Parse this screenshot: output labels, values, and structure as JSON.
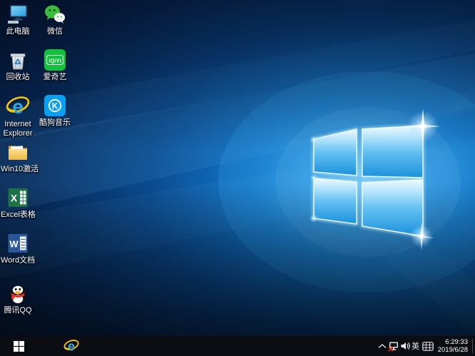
{
  "desktop": {
    "icons": [
      {
        "name": "this-pc",
        "label": "此电脑"
      },
      {
        "name": "wechat",
        "label": "微信"
      },
      {
        "name": "recycle-bin",
        "label": "回收站"
      },
      {
        "name": "iqiyi",
        "label": "爱奇艺",
        "logo_text": "iQIYI"
      },
      {
        "name": "internet-explorer",
        "label_line1": "Internet",
        "label_line2": "Explorer",
        "logo_text": "e"
      },
      {
        "name": "kugou-music",
        "label": "酷狗音乐",
        "logo_text": "K"
      },
      {
        "name": "win10-activation",
        "label": "Win10激活"
      },
      {
        "name": "excel",
        "label": "Excel表格",
        "logo_text": "X"
      },
      {
        "name": "word",
        "label": "Word文档",
        "logo_text": "W"
      },
      {
        "name": "tencent-qq",
        "label": "腾讯QQ"
      }
    ]
  },
  "taskbar": {
    "ie_logo_text": "e",
    "tray": {
      "ime_indicator": "英",
      "time": "6:29:33",
      "date": "2019/6/28"
    }
  },
  "colors": {
    "wallpaper_dark_navy": "#041430",
    "wallpaper_glow_blue": "#2f9de6",
    "pane_light_blue": "#b9e6fb",
    "taskbar_bg": "#0b0d12",
    "wechat_green": "#3cbe3c",
    "iqiyi_green": "#12c13c",
    "kugou_blue": "#0aa0f2",
    "ie_blue": "#2fb3ec",
    "ie_swoosh_yellow": "#f5c70d",
    "excel_green": "#1e7145",
    "word_blue": "#2b579a",
    "folder_yellow": "#f6c95c",
    "qq_scarf_red": "#e43028",
    "tray_error_red": "#e0352b"
  }
}
